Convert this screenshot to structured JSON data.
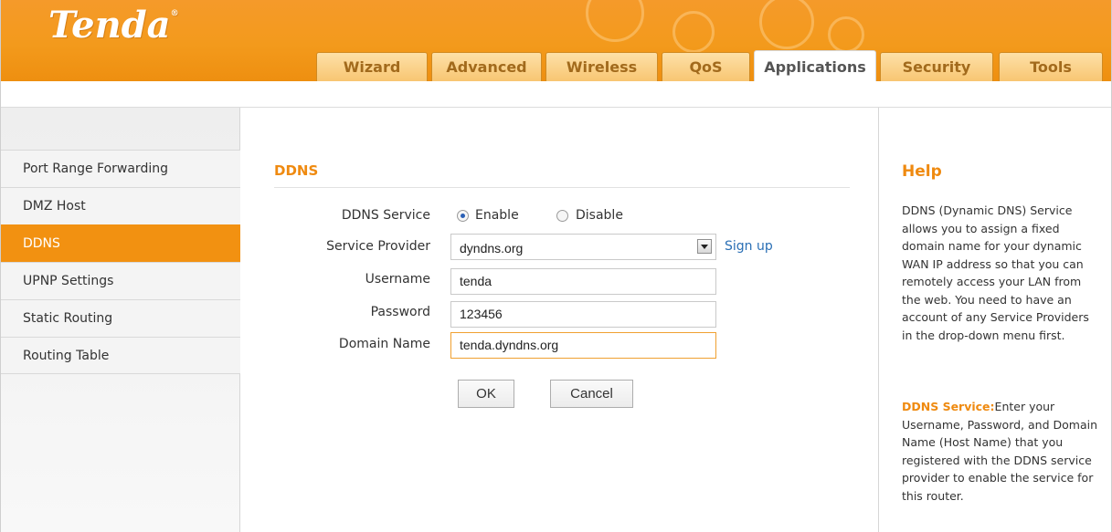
{
  "brand": {
    "logo": "Tenda",
    "mark": "®"
  },
  "tabs": [
    "Wizard",
    "Advanced",
    "Wireless",
    "QoS",
    "Applications",
    "Security",
    "Tools"
  ],
  "active_tab": "Applications",
  "sidebar": {
    "items": [
      "Port Range Forwarding",
      "DMZ Host",
      "DDNS",
      "UPNP Settings",
      "Static Routing",
      "Routing Table"
    ],
    "active": "DDNS"
  },
  "form": {
    "title": "DDNS",
    "service_label": "DDNS Service",
    "enable_label": "Enable",
    "disable_label": "Disable",
    "service_selected": "Enable",
    "provider_label": "Service Provider",
    "provider_value": "dyndns.org",
    "signup_label": "Sign up",
    "username_label": "Username",
    "username_value": "tenda",
    "password_label": "Password",
    "password_value": "123456",
    "domain_label": "Domain Name",
    "domain_value": "tenda.dyndns.org",
    "ok_label": "OK",
    "cancel_label": "Cancel"
  },
  "help": {
    "title": "Help",
    "intro": "DDNS (Dynamic DNS) Service allows you to assign a fixed domain name for your dynamic WAN IP address so that you can remotely access your LAN from the web. You need to have an account of any Service Providers in the drop-down menu first.",
    "service_heading": "DDNS Service:",
    "service_text": "Enter your Username, Password, and Domain Name (Host Name) that you registered with the DDNS service provider to enable the service for this router."
  },
  "colors": {
    "accent": "#f29111",
    "link": "#2a6fb5",
    "tab_text": "#a26a1c"
  }
}
